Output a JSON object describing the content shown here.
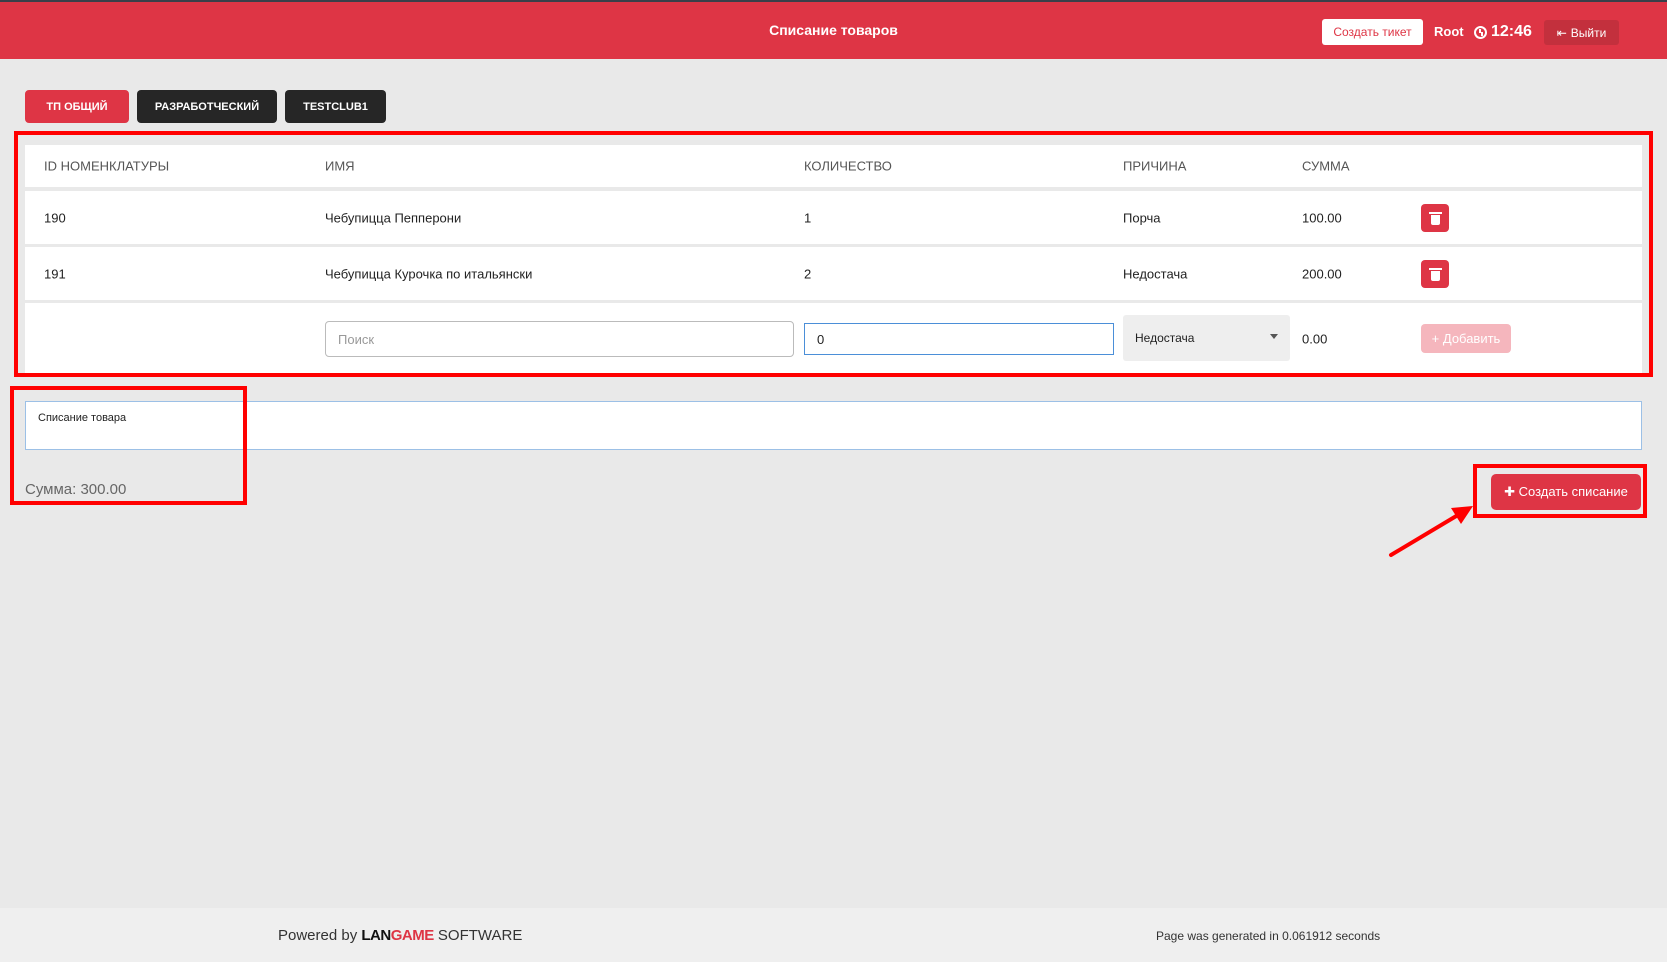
{
  "header": {
    "title": "Списание товаров",
    "ticket_label": "Создать тикет",
    "user": "Root",
    "time": "12:46",
    "logout_label": "Выйти"
  },
  "tabs": [
    {
      "label": "ТП ОБЩИЙ",
      "active": true
    },
    {
      "label": "РАЗРАБОТЧЕСКИЙ",
      "active": false
    },
    {
      "label": "TESTCLUB1",
      "active": false
    }
  ],
  "table": {
    "columns": [
      "ID НОМЕНКЛАТУРЫ",
      "ИМЯ",
      "КОЛИЧЕСТВО",
      "ПРИЧИНА",
      "СУММА"
    ],
    "rows": [
      {
        "id": "190",
        "name": "Чебупицца Пепперони",
        "qty": "1",
        "reason": "Порча",
        "sum": "100.00"
      },
      {
        "id": "191",
        "name": "Чебупицца Курочка по итальянски",
        "qty": "2",
        "reason": "Недостача",
        "sum": "200.00"
      }
    ],
    "new_row": {
      "search_placeholder": "Поиск",
      "qty_value": "0",
      "reason_selected": "Недостача",
      "sum": "0.00",
      "add_label": "+ Добавить"
    }
  },
  "note": {
    "value": "Списание товара"
  },
  "total": "Сумма: 300.00",
  "create_label": "✚  Создать списание",
  "footer": {
    "powered_prefix": "Powered by",
    "brand_a": "LAN",
    "brand_b": "GAME",
    "brand_suffix": "SOFTWARE",
    "generated": "Page was generated in 0.061912 seconds"
  },
  "colors": {
    "accent": "#de3545",
    "dark_tab": "#262626",
    "highlight": "#ff0000"
  }
}
